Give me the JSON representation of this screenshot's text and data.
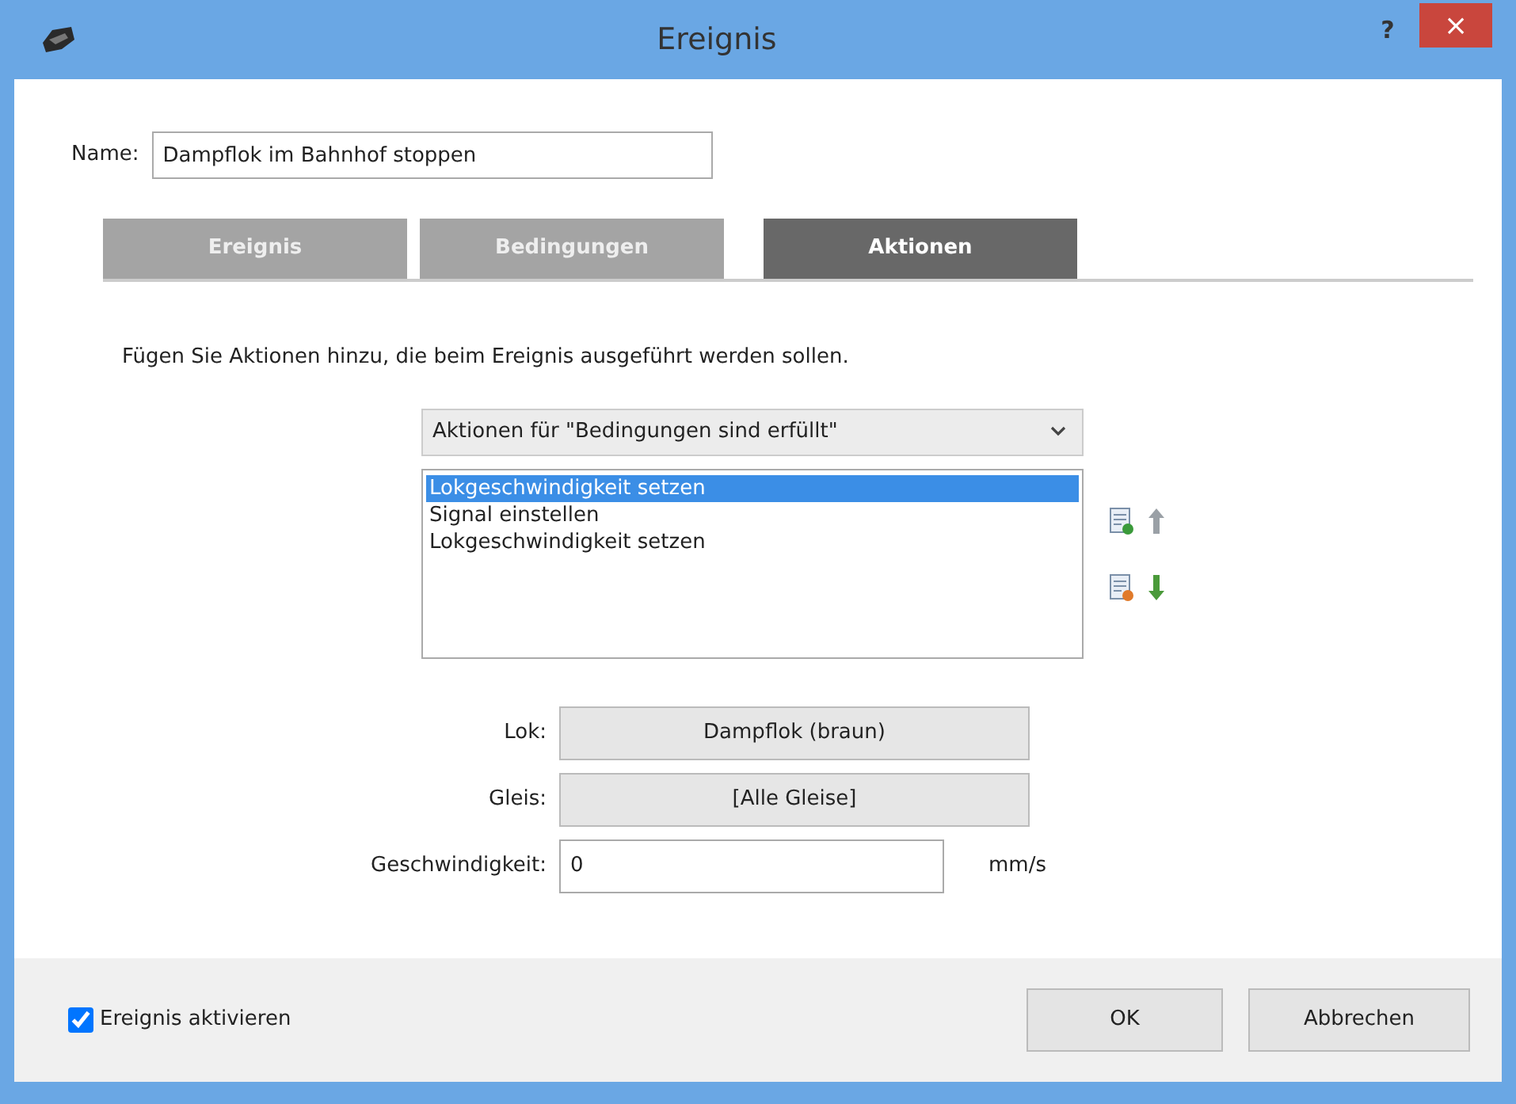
{
  "window": {
    "title": "Ereignis",
    "help": "?",
    "close": "×"
  },
  "name": {
    "label": "Name:",
    "value": "Dampflok im Bahnhof stoppen"
  },
  "tabs": [
    {
      "label": "Ereignis",
      "selected": false
    },
    {
      "label": "Bedingungen",
      "selected": false
    },
    {
      "label": "Aktionen",
      "selected": true
    }
  ],
  "description": "Fügen Sie Aktionen hinzu, die beim Ereignis ausgeführt werden sollen.",
  "dropdown": {
    "value": "Aktionen für \"Bedingungen sind erfüllt\""
  },
  "actions": [
    {
      "label": "Lokgeschwindigkeit setzen",
      "selected": true
    },
    {
      "label": "Signal einstellen",
      "selected": false
    },
    {
      "label": "Lokgeschwindigkeit setzen",
      "selected": false
    }
  ],
  "fields": [
    {
      "kind": "button",
      "label": "Lok:",
      "value": "Dampflok (braun)"
    },
    {
      "kind": "button",
      "label": "Gleis:",
      "value": "[Alle Gleise]"
    },
    {
      "kind": "input",
      "label": "Geschwindigkeit:",
      "value": "0",
      "unit": "mm/s"
    }
  ],
  "footer": {
    "checkbox": {
      "label": "Ereignis aktivieren",
      "checked": true
    },
    "buttons": [
      "OK",
      "Abbrechen"
    ]
  }
}
